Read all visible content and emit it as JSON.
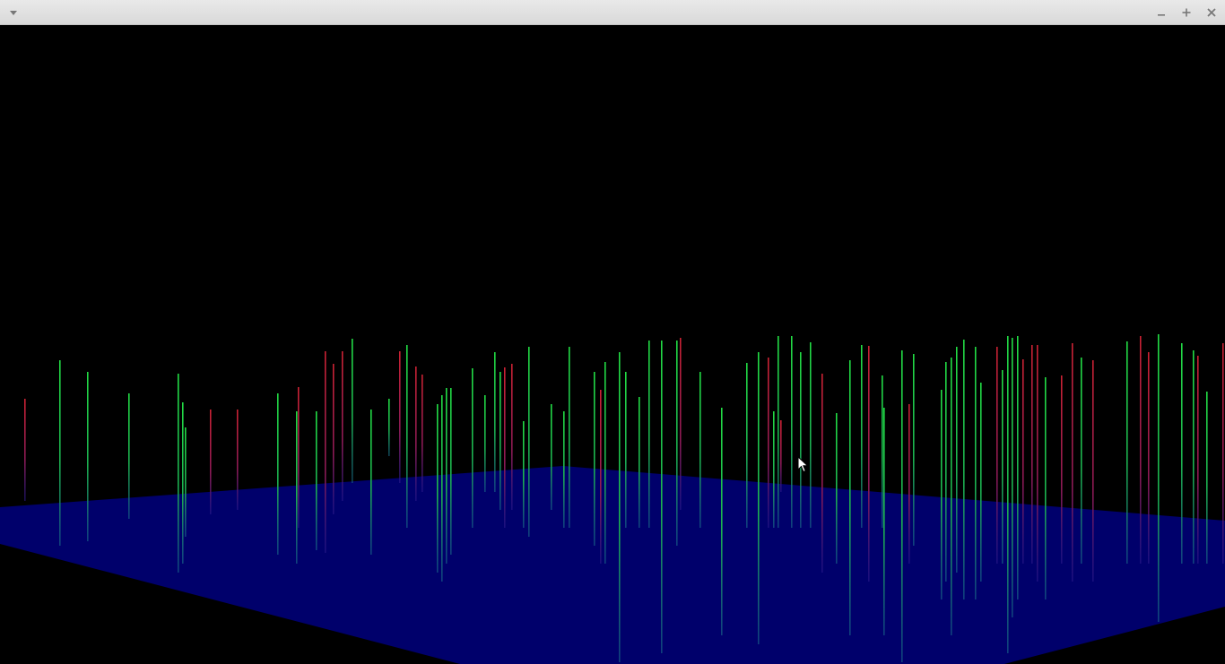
{
  "window": {
    "title": "",
    "menu_icon": "chevron-down-icon",
    "minimize_icon": "minimize-icon",
    "maximize_icon": "maximize-icon",
    "close_icon": "close-icon"
  },
  "scene": {
    "description_type": "3d-bar-visualization",
    "background_color": "#000000",
    "plane_color": "#000066",
    "bar_colors": {
      "green": "#22dd44",
      "red": "#cc2233",
      "teal": "#2a8a8a"
    }
  },
  "cursor": {
    "icon": "mouse-pointer-icon"
  }
}
